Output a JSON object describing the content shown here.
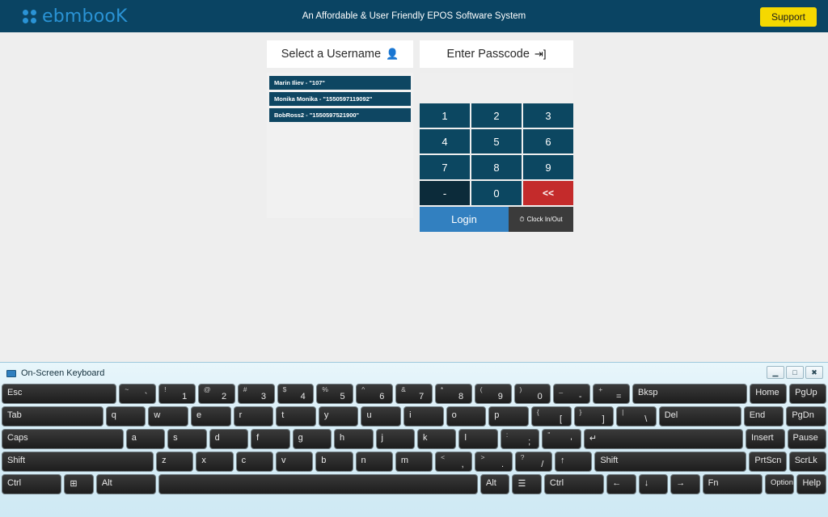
{
  "header": {
    "brand": "ebmbooK",
    "brand_icon": "clover-icon",
    "tagline": "An Affordable & User Friendly EPOS Software System",
    "support_label": "Support",
    "brand_color": "#2a93d5",
    "bar_color": "#0a4463",
    "support_color": "#f5d800"
  },
  "login": {
    "username_panel": {
      "title": "Select a Username",
      "icon": "person-icon",
      "users": [
        "Marin Iliev - \"107\"",
        "Monika Monika - \"1550597119092\"",
        "BobRoss2 - \"1550597521900\""
      ]
    },
    "passcode_panel": {
      "title": "Enter Passcode",
      "icon": "sign-in-icon",
      "display_value": "",
      "keys": [
        "1",
        "2",
        "3",
        "4",
        "5",
        "6",
        "7",
        "8",
        "9",
        "-",
        "0",
        "<<"
      ],
      "backspace_label": "<<",
      "login_label": "Login",
      "clock_label": "Clock In/Out",
      "clock_icon": "clock-icon",
      "login_color": "#3280c0",
      "backspace_color": "#c42b2b",
      "key_color": "#0c4761"
    }
  },
  "osk": {
    "title": "On-Screen Keyboard",
    "icon": "keyboard-icon",
    "window_buttons": [
      {
        "name": "minimize",
        "glyph": "▁"
      },
      {
        "name": "maximize",
        "glyph": "□"
      },
      {
        "name": "close",
        "glyph": "✖"
      }
    ],
    "rows": [
      [
        {
          "main": "Esc",
          "w": "wide3"
        },
        {
          "main": "`",
          "sub": "~",
          "dual": true
        },
        {
          "main": "1",
          "sub": "!",
          "dual": true
        },
        {
          "main": "2",
          "sub": "@",
          "dual": true
        },
        {
          "main": "3",
          "sub": "#",
          "dual": true
        },
        {
          "main": "4",
          "sub": "$",
          "dual": true
        },
        {
          "main": "5",
          "sub": "%",
          "dual": true
        },
        {
          "main": "6",
          "sub": "^",
          "dual": true
        },
        {
          "main": "7",
          "sub": "&",
          "dual": true
        },
        {
          "main": "8",
          "sub": "*",
          "dual": true
        },
        {
          "main": "9",
          "sub": "(",
          "dual": true
        },
        {
          "main": "0",
          "sub": ")",
          "dual": true
        },
        {
          "main": "-",
          "sub": "_",
          "dual": true
        },
        {
          "main": "=",
          "sub": "+",
          "dual": true
        },
        {
          "main": "Bksp",
          "w": "wide3"
        },
        {
          "main": "Home"
        },
        {
          "main": "PgUp"
        }
      ],
      [
        {
          "main": "Tab",
          "w": "wide25"
        },
        {
          "main": "q"
        },
        {
          "main": "w"
        },
        {
          "main": "e"
        },
        {
          "main": "r"
        },
        {
          "main": "t"
        },
        {
          "main": "y"
        },
        {
          "main": "u"
        },
        {
          "main": "i"
        },
        {
          "main": "o"
        },
        {
          "main": "p"
        },
        {
          "main": "[",
          "sub": "{",
          "dual": true
        },
        {
          "main": "]",
          "sub": "}",
          "dual": true
        },
        {
          "main": "\\",
          "sub": "|",
          "dual": true
        },
        {
          "main": "Del",
          "w": "wide2"
        },
        {
          "main": "End"
        },
        {
          "main": "PgDn"
        }
      ],
      [
        {
          "main": "Caps",
          "w": "wide3"
        },
        {
          "main": "a"
        },
        {
          "main": "s"
        },
        {
          "main": "d"
        },
        {
          "main": "f"
        },
        {
          "main": "g"
        },
        {
          "main": "h"
        },
        {
          "main": "j"
        },
        {
          "main": "k"
        },
        {
          "main": "l"
        },
        {
          "main": ";",
          "sub": ":",
          "dual": true
        },
        {
          "main": "'",
          "sub": "\"",
          "dual": true
        },
        {
          "main": "↵",
          "w": "wide4"
        },
        {
          "main": "Insert"
        },
        {
          "main": "Pause"
        }
      ],
      [
        {
          "main": "Shift",
          "w": "wide4"
        },
        {
          "main": "z"
        },
        {
          "main": "x"
        },
        {
          "main": "c"
        },
        {
          "main": "v"
        },
        {
          "main": "b"
        },
        {
          "main": "n"
        },
        {
          "main": "m"
        },
        {
          "main": ",",
          "sub": "<",
          "dual": true
        },
        {
          "main": ".",
          "sub": ">",
          "dual": true
        },
        {
          "main": "/",
          "sub": "?",
          "dual": true
        },
        {
          "main": "↑",
          "sub": ""
        },
        {
          "main": "Shift",
          "w": "wide4"
        },
        {
          "main": "PrtScn"
        },
        {
          "main": "ScrLk"
        }
      ],
      [
        {
          "main": "Ctrl",
          "w": "wide2"
        },
        {
          "main": "⊞"
        },
        {
          "main": "Alt",
          "w": "wide2"
        },
        {
          "main": "",
          "w": "space"
        },
        {
          "main": "Alt"
        },
        {
          "main": "☰"
        },
        {
          "main": "Ctrl",
          "w": "wide2"
        },
        {
          "main": "←"
        },
        {
          "main": "↓"
        },
        {
          "main": "→"
        },
        {
          "main": "Fn",
          "w": "wide2"
        },
        {
          "main": "Options",
          "small": true
        },
        {
          "main": "Help"
        }
      ]
    ]
  }
}
